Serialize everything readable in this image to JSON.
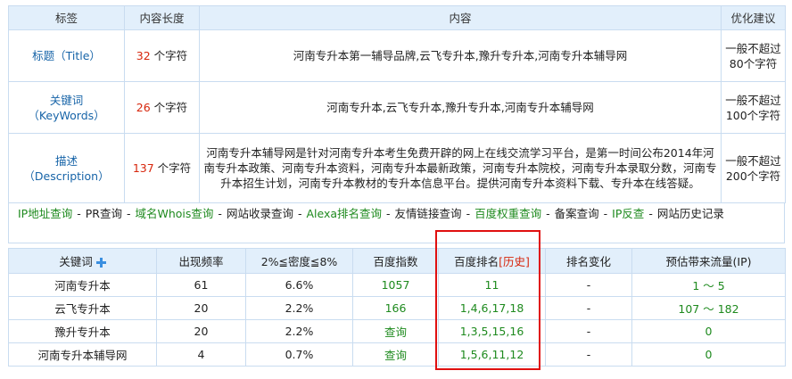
{
  "seo_table": {
    "headers": [
      "标签",
      "内容长度",
      "内容",
      "优化建议"
    ],
    "rows": [
      {
        "label": "标题（Title）",
        "count": "32",
        "unit": " 个字符",
        "content": "河南专升本第一辅导品牌,云飞专升本,豫升专升本,河南专升本辅导网",
        "advice": "一般不超过80个字符"
      },
      {
        "label_line1": "关键词",
        "label_line2": "（KeyWords）",
        "count": "26",
        "unit": " 个字符",
        "content": "河南专升本,云飞专升本,豫升专升本,河南专升本辅导网",
        "advice": "一般不超过100个字符"
      },
      {
        "label_line1": "描述",
        "label_line2": "（Description）",
        "count": "137",
        "unit": " 个字符",
        "content": "河南专升本辅导网是针对河南专升本考生免费开辟的网上在线交流学习平台，是第一时间公布2014年河南专升本政策、河南专升本资料，河南专升本最新政策，河南专升本院校，河南专升本录取分数，河南专升本招生计划，河南专升本教材的专升本信息平台。提供河南专升本资料下载、专升本在线答疑。",
        "advice": "一般不超过200个字符"
      }
    ]
  },
  "tool_links": [
    {
      "label": "IP地址查询",
      "color": "green"
    },
    {
      "label": "PR查询",
      "color": "plain"
    },
    {
      "label": "域名Whois查询",
      "color": "green"
    },
    {
      "label": "网站收录查询",
      "color": "plain"
    },
    {
      "label": "Alexa排名查询",
      "color": "green"
    },
    {
      "label": "友情链接查询",
      "color": "plain"
    },
    {
      "label": "百度权重查询",
      "color": "green"
    },
    {
      "label": "备案查询",
      "color": "plain"
    },
    {
      "label": "IP反查",
      "color": "green"
    },
    {
      "label": "网站历史记录",
      "color": "plain"
    }
  ],
  "keyword_table": {
    "headers": {
      "keyword": "关键词",
      "frequency": "出现频率",
      "density": "2%≦密度≦8%",
      "baidu_index": "百度指数",
      "baidu_rank": "百度排名",
      "history": "[历史]",
      "rank_change": "排名变化",
      "traffic": "预估带来流量(IP)"
    },
    "rows": [
      {
        "keyword": "河南专升本",
        "frequency": "61",
        "density": "6.6%",
        "index": "1057",
        "rank": "11",
        "change": "-",
        "traffic": "1 ～ 5"
      },
      {
        "keyword": "云飞专升本",
        "frequency": "20",
        "density": "2.2%",
        "index": "166",
        "rank": "1,4,6,17,18",
        "change": "-",
        "traffic": "107 ～ 182"
      },
      {
        "keyword": "豫升专升本",
        "frequency": "20",
        "density": "2.2%",
        "index": "查询",
        "rank": "1,3,5,15,16",
        "change": "-",
        "traffic": "0"
      },
      {
        "keyword": "河南专升本辅导网",
        "frequency": "4",
        "density": "0.7%",
        "index": "查询",
        "rank": "1,5,6,11,12",
        "change": "-",
        "traffic": "0"
      }
    ]
  },
  "colors": {
    "link_green": "#1e8a1e",
    "label_blue": "#1764a8",
    "count_red": "#d7260c",
    "header_bg": "#e2effb",
    "highlight_red": "#e01010"
  }
}
